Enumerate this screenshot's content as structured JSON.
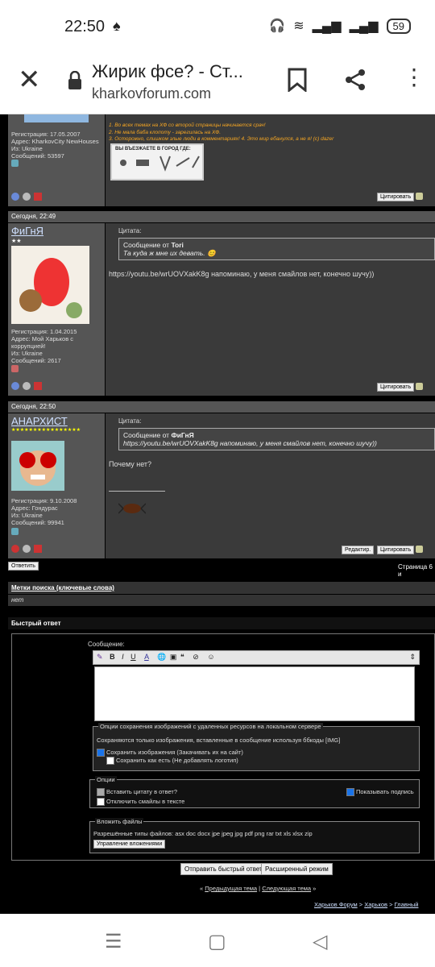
{
  "status": {
    "time": "22:50",
    "battery": "59"
  },
  "browser": {
    "title": "Жирик фсе? - Ст...",
    "url": "kharkovforum.com"
  },
  "post0": {
    "reg": "Регистрация: 17.05.2007",
    "address": "Адрес: KharkovCity NewHouses",
    "from": "Из: Ukraine",
    "messages": "Сообщений: 53597",
    "sig1": "1. Во всех темах на ХФ со второй страницы начинается срач!",
    "sig2": "2. Не мала баба клопоту - зарегилась на ХФ.",
    "sig3": "3. Осторожно, слишком злые люди в комментариях! 4. Это мир ебанулся, а не я! (c) dazer",
    "sign_caption": "ВЫ ВЪЕЗЖАЕТЕ В ГОРОД ГДЕ:",
    "quote_btn": "Цитировать"
  },
  "post1": {
    "date": "Сегодня, 22:49",
    "username": "ФиГнЯ",
    "stars": "★★",
    "reg": "Регистрация: 1.04.2015",
    "address": "Адрес: Мой Харьков с",
    "address2": "коррупцией!",
    "from": "Из: Ukraine",
    "messages": "Сообщений: 2617",
    "quote_label": "Цитата:",
    "quote_from": "Сообщение от",
    "quote_author": "Tori",
    "quote_text": "Та куда ж мне их девать.",
    "text": "https://youtu.be/wrUOVXakK8g напоминаю, у меня смайлов нет, конечно шучу))",
    "quote_btn": "Цитировать"
  },
  "post2": {
    "date": "Сегодня, 22:50",
    "username": "АНАРХИСТ",
    "stars": "★★★★★★★★★★★★★★★★",
    "reg": "Регистрация: 9.10.2008",
    "address": "Адрес: Гондурас",
    "from": "Из: Ukraine",
    "messages": "Сообщений: 99941",
    "quote_label": "Цитата:",
    "quote_from": "Сообщение от",
    "quote_author": "ФиГнЯ",
    "quote_text": "https://youtu.be/wrUOVXakK8g напоминаю, у меня смайлов нет, конечно шучу))",
    "text": "Почему нет?",
    "edit_btn": "Редактир.",
    "quote_btn": "Цитировать"
  },
  "reply_btn": "Ответить",
  "page_info": "Страница 6 и",
  "tags_head": "Метки поиска (ключевые слова)",
  "tags_value": "нет",
  "quick_reply": "Быстрый ответ",
  "message_label": "Сообщение:",
  "img_options": {
    "legend": "Опции сохранения изображений с удаленных ресурсов на локальном сервере",
    "note": "Сохраняются только изображения, вставленные в сообщение используя ббкоды [IMG]",
    "opt1": "Сохранить изображения (Закачивать их на сайт)",
    "opt2": "Сохранить как есть (Не добавлять логотип)"
  },
  "options": {
    "legend": "Опции",
    "quote": "Вставить цитату в ответ?",
    "show_sig": "Показывать подпись",
    "disable_smilies": "Отключить смайлы в тексте"
  },
  "attach": {
    "legend": "Вложить файлы",
    "types": "Разрешённые типы файлов: asx doc docx jpe jpeg jpg pdf png rar txt xls xlsx zip",
    "manage_btn": "Управление вложениями"
  },
  "send_btn": "Отправить быстрый ответ",
  "advanced_btn": "Расширенный режим",
  "prev_topic": "Предыдущая тема",
  "next_topic": "Следующая тема",
  "breadcrumb": {
    "a": "Харьков Форум",
    "b": "Харьков",
    "c": "Главный"
  }
}
